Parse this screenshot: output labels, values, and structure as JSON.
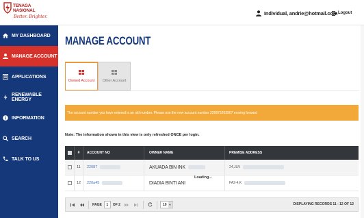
{
  "header": {
    "logo_line1": "TENAGA",
    "logo_line2": "NASIONAL",
    "logo_tagline": "Better. Brighter.",
    "user_text": "Individual, andrie@hotmail.com",
    "logout_label": "Logout",
    "brand_color": "#c8241d"
  },
  "sidebar": {
    "bg_color": "#14387a",
    "active_color": "#d6322c",
    "items": [
      {
        "label": "MY DASHBOARD",
        "icon": "home-icon"
      },
      {
        "label": "MANAGE ACCOUNT",
        "icon": "user-icon",
        "active": true
      },
      {
        "label": "APPLICATIONS",
        "icon": "list-icon"
      },
      {
        "label": "RENEWABLE ENERGY",
        "icon": "bolt-icon"
      },
      {
        "label": "INFORMATION",
        "icon": "info-icon"
      },
      {
        "label": "SEARCH",
        "icon": "search-icon"
      },
      {
        "label": "TALK TO US",
        "icon": "phone-icon"
      }
    ]
  },
  "main": {
    "title": "MANAGE ACCOUNT",
    "tabs": [
      {
        "label": "Owned Account",
        "active": true
      },
      {
        "label": "Other Account",
        "active": false
      }
    ],
    "alert": "The account number you have entered is an old number. Please use the new account number 220873253907 moving forward",
    "note": "Note: The information shown in this view is only refreshed ONCE per login.",
    "loading_text": "Loading...",
    "table": {
      "columns": [
        "#",
        "ACCOUNT NO",
        "OWNER NAME",
        "PREMISE ADDRESS"
      ],
      "rows": [
        {
          "num": "11",
          "account": "22087",
          "owner": "AKUADA BIN INK",
          "premise": "24,JLN"
        },
        {
          "num": "12",
          "account": "220a45",
          "owner": "DIADIA BINTI ANI",
          "premise": "FA2-4,K"
        }
      ]
    },
    "pager": {
      "page_label": "PAGE",
      "page_value": "1",
      "of_label": "OF 2",
      "page_size": "10",
      "info": "DISPLAYING RECORDS 11 - 12 OF 12"
    }
  }
}
